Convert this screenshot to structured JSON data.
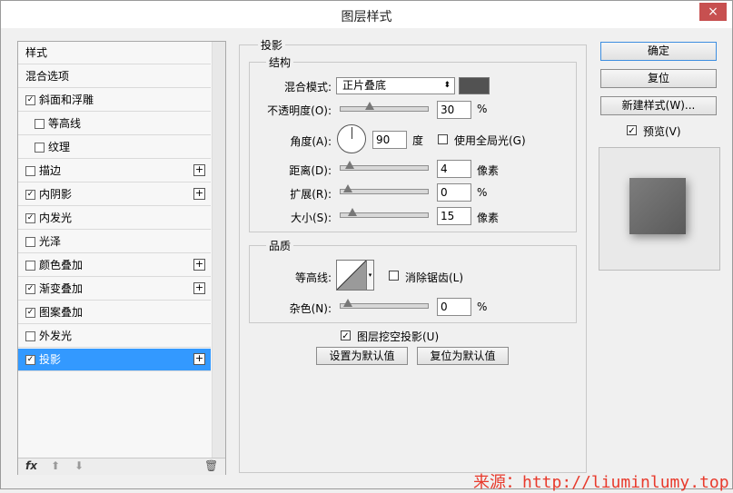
{
  "window": {
    "title": "图层样式",
    "close_glyph": "×"
  },
  "style_list": {
    "items": [
      {
        "label": "样式",
        "checkbox": false,
        "checked": false,
        "plus": false,
        "indent": false,
        "selected": false
      },
      {
        "label": "混合选项",
        "checkbox": false,
        "checked": false,
        "plus": false,
        "indent": false,
        "selected": false
      },
      {
        "label": "斜面和浮雕",
        "checkbox": true,
        "checked": true,
        "plus": false,
        "indent": false,
        "selected": false
      },
      {
        "label": "等高线",
        "checkbox": true,
        "checked": false,
        "plus": false,
        "indent": true,
        "selected": false
      },
      {
        "label": "纹理",
        "checkbox": true,
        "checked": false,
        "plus": false,
        "indent": true,
        "selected": false
      },
      {
        "label": "描边",
        "checkbox": true,
        "checked": false,
        "plus": true,
        "indent": false,
        "selected": false
      },
      {
        "label": "内阴影",
        "checkbox": true,
        "checked": true,
        "plus": true,
        "indent": false,
        "selected": false
      },
      {
        "label": "内发光",
        "checkbox": true,
        "checked": true,
        "plus": false,
        "indent": false,
        "selected": false
      },
      {
        "label": "光泽",
        "checkbox": true,
        "checked": false,
        "plus": false,
        "indent": false,
        "selected": false
      },
      {
        "label": "颜色叠加",
        "checkbox": true,
        "checked": false,
        "plus": true,
        "indent": false,
        "selected": false
      },
      {
        "label": "渐变叠加",
        "checkbox": true,
        "checked": true,
        "plus": true,
        "indent": false,
        "selected": false
      },
      {
        "label": "图案叠加",
        "checkbox": true,
        "checked": true,
        "plus": false,
        "indent": false,
        "selected": false
      },
      {
        "label": "外发光",
        "checkbox": true,
        "checked": false,
        "plus": false,
        "indent": false,
        "selected": false
      },
      {
        "label": "投影",
        "checkbox": true,
        "checked": true,
        "plus": true,
        "indent": false,
        "selected": true
      }
    ],
    "footer": {
      "fx": "fx",
      "up_glyph": "⬆",
      "down_glyph": "⬇",
      "trash_glyph": "🗑"
    }
  },
  "icons": {
    "checkmark": "✓",
    "plus": "+",
    "dropdown": "⬍",
    "dropdown_small": "▾"
  },
  "drop_shadow": {
    "section_title": "投影",
    "structure": {
      "title": "结构",
      "blend_mode": {
        "label": "混合模式:",
        "value": "正片叠底",
        "color": "#525252"
      },
      "opacity": {
        "label": "不透明度(O):",
        "value": "30",
        "unit": "%",
        "level": 0.3
      },
      "angle": {
        "label": "角度(A):",
        "value": "90",
        "unit": "度",
        "global_light_label": "使用全局光(G)",
        "global_light_checked": false
      },
      "distance": {
        "label": "距离(D):",
        "value": "4",
        "unit": "像素",
        "level": 0.02
      },
      "spread": {
        "label": "扩展(R):",
        "value": "0",
        "unit": "%",
        "level": 0.0
      },
      "size": {
        "label": "大小(S):",
        "value": "15",
        "unit": "像素",
        "level": 0.06
      }
    },
    "quality": {
      "title": "品质",
      "contour": {
        "label": "等高线:",
        "antialias_label": "消除锯齿(L)",
        "antialias_checked": false
      },
      "noise": {
        "label": "杂色(N):",
        "value": "0",
        "unit": "%",
        "level": 0.0
      }
    },
    "knockout": {
      "label": "图层挖空投影(U)",
      "checked": true
    },
    "set_default_label": "设置为默认值",
    "reset_default_label": "复位为默认值"
  },
  "buttons": {
    "ok": "确定",
    "reset": "复位",
    "new_style": "新建样式(W)...",
    "preview_label": "预览(V)",
    "preview_checked": true
  },
  "watermark": "来源：http://liuminlumy.top"
}
